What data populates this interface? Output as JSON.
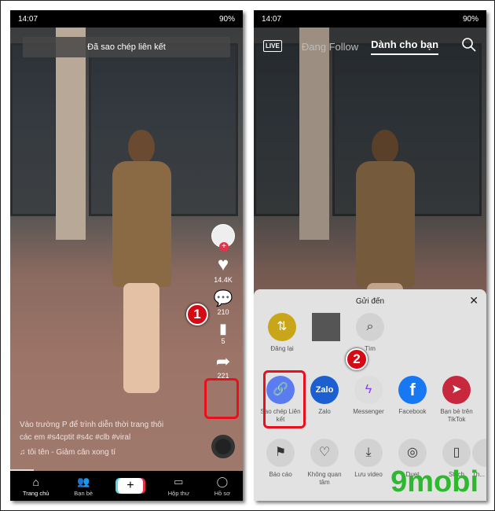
{
  "status": {
    "time": "14:07",
    "battery": "90%"
  },
  "left": {
    "toast": "Đã sao chép liên kết",
    "rail": {
      "likes": "14.4K",
      "comments": "210",
      "saves": "5",
      "shares": "221"
    },
    "caption": "Vào trường P để trình diễn thời trang thôi các em #s4cptit #s4c #clb #viral",
    "music": "♫ tôi tên - Giảm cân xong tí",
    "step": "1"
  },
  "right": {
    "live": "LIVE",
    "tabs": [
      "Đang Follow",
      "Dành cho bạn"
    ],
    "sheet_title": "Gửi đến",
    "row1": [
      "Đăng lại",
      "",
      "Tìm"
    ],
    "row2": [
      "Sao chép Liên kết",
      "Zalo",
      "Messenger",
      "Facebook",
      "Bạn bè trên TikTok"
    ],
    "row3": [
      "Báo cáo",
      "Không quan tâm",
      "Lưu video",
      "Duet",
      "Stitch",
      "Th..."
    ],
    "step": "2"
  },
  "nav": [
    "Trang chủ",
    "Bạn bè",
    "+",
    "Hộp thư",
    "Hồ sơ"
  ],
  "watermark": "9mobi.vn",
  "colors": {
    "accent": "#e8304a",
    "highlight": "#e8101c",
    "link": "#5b7cf0",
    "facebook": "#1877f2",
    "repost": "#c9a51a"
  }
}
